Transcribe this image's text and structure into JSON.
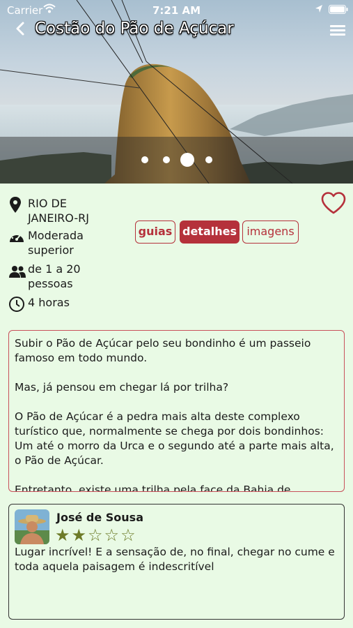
{
  "status_bar": {
    "carrier": "Carrier",
    "time": "7:21 AM"
  },
  "header": {
    "title": "Costão do Pão de Açúcar",
    "back_icon": "chevron-left-icon",
    "menu_icon": "hamburger-menu-icon"
  },
  "carousel": {
    "slide_count": 4,
    "active_index": 2
  },
  "details": {
    "location": "RIO DE JANEIRO-RJ",
    "difficulty": "Moderada superior",
    "group_size": "de 1 a 20 pessoas",
    "duration": "4 horas"
  },
  "tabs": [
    {
      "label": "guias"
    },
    {
      "label": "detalhes"
    },
    {
      "label": "imagens"
    }
  ],
  "description": {
    "paragraphs": [
      "Subir o Pão de Açúcar pelo seu bondinho é um passeio famoso em todo mundo.",
      "Mas, já pensou em chegar lá por trilha?",
      "O Pão de Açúcar é a pedra mais alta deste complexo turístico que, normalmente se chega por dois bondinhos: Um até o morro da Urca e o segundo até a parte mais alta, o Pão de Açúcar.",
      "Entretanto, existe uma trilha pela face da Bahia de"
    ]
  },
  "review": {
    "name": "José de Sousa",
    "rating": 2,
    "max_rating": 5,
    "text": "Lugar incrível! E a sensação de, no final, chegar no cume e toda aquela paisagem é indescritível"
  },
  "colors": {
    "accent": "#b5313b",
    "background": "#e9fae5",
    "star": "#6d7b28"
  }
}
